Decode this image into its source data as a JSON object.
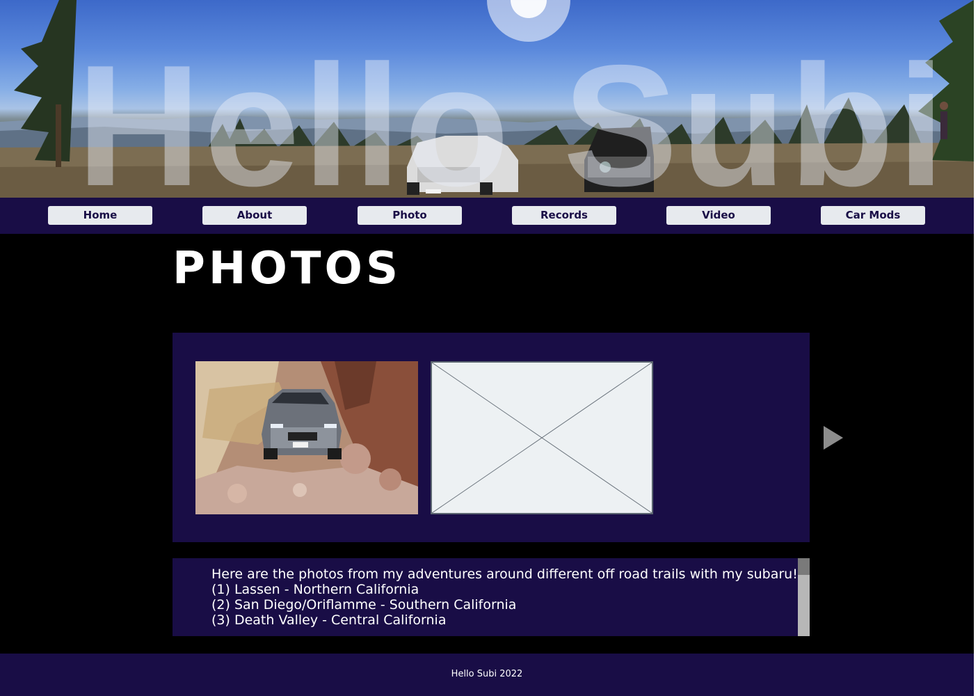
{
  "banner": {
    "title": "Hello Subi",
    "image": "panorama of two off-road vehicles on a mountain meadow with pine trees"
  },
  "nav": {
    "items": [
      {
        "label": "Home"
      },
      {
        "label": "About"
      },
      {
        "label": "Photo"
      },
      {
        "label": "Records"
      },
      {
        "label": "Video"
      },
      {
        "label": "Car Mods"
      }
    ]
  },
  "page": {
    "title": "PHOTOS"
  },
  "gallery": {
    "photos": [
      {
        "kind": "photo",
        "subject": "silver subaru on rocky desert trail"
      },
      {
        "kind": "placeholder"
      }
    ],
    "next_icon": "play-arrow-icon"
  },
  "description": {
    "lines": [
      "Here are the photos from my adventures around different off road trails with my subaru!",
      "(1) Lassen - Northern California",
      "(2) San Diego/Oriflamme - Southern California",
      "(3) Death Valley - Central California"
    ]
  },
  "footer": {
    "text": "Hello Subi 2022"
  },
  "colors": {
    "brand_navy": "#190d46",
    "nav_button": "#e7eaee",
    "background": "#000000"
  }
}
